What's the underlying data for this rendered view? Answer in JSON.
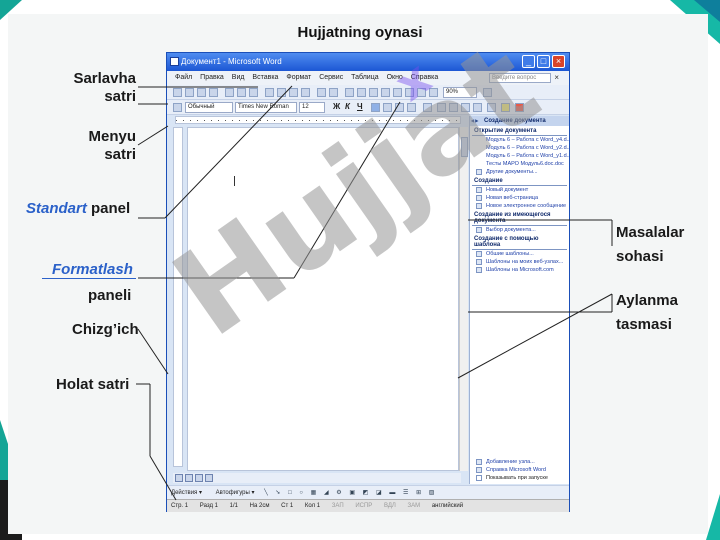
{
  "slide": {
    "title": "Hujjatning oynasi",
    "labels": {
      "title_bar": [
        "Sarlavha",
        "satri"
      ],
      "menu_bar": [
        "Menyu",
        "satri"
      ],
      "standard_panel_em": "Standart",
      "standard_panel_rest": "panel",
      "formatting_em": "Formatlash",
      "formatting_rest": "paneli",
      "ruler": "Chizg’ich",
      "status_bar": "Holat satri",
      "tables_area": [
        "Masalalar",
        "sohasi"
      ],
      "scrollbar": [
        "Aylanma",
        "tasmasi"
      ]
    },
    "watermark": "Hujjat",
    "watermark_accent": "x",
    "accent_color": "#2b61c9",
    "deco_color": "#16b8a6"
  },
  "word": {
    "window_title": "Документ1 - Microsoft Word",
    "menu": [
      "Файл",
      "Правка",
      "Вид",
      "Вставка",
      "Формат",
      "Сервис",
      "Таблица",
      "Окно",
      "Справка"
    ],
    "ask_placeholder": "Введите вопрос",
    "style_value": "Обычный",
    "font_value": "Times New Roman",
    "size_value": "12",
    "zoom_value": "90%",
    "task_pane": {
      "header": "Создание документа",
      "open_section": "Открытие документа",
      "open_items": [
        "Модуль 6 – Работа с Word_y4.d...",
        "Модуль 6 – Работа с Word_y2.d...",
        "Модуль 6 – Работа с Word_y1.d...",
        "Тесты МАРО Модуль6.doc.doc"
      ],
      "more_docs": "Другие документы...",
      "create_section": "Создание",
      "create_items": [
        "Новый документ",
        "Новая веб-страница",
        "Новое электронное сообщение"
      ],
      "from_existing_section": "Создание из имеющегося документа",
      "from_existing_item": "Выбор документа...",
      "template_section": "Создание с помощью шаблона",
      "template_items": [
        "Обшие шаблоны...",
        "Шаблоны на моих веб-узлах...",
        "Шаблоны на Microsoft.com"
      ],
      "footer_items": [
        "Добавление узла...",
        "Справка Microsoft Word",
        "Показывать при запуске"
      ]
    },
    "drawing_bar": [
      "Действия ▾",
      "Автофигуры ▾"
    ],
    "status": [
      "Стр. 1",
      "Разд 1",
      "1/1",
      "На 2см",
      "Ст 1",
      "Кол 1",
      "ЗАП",
      "ИСПР",
      "ВДЛ",
      "ЗАМ",
      "английский"
    ]
  }
}
